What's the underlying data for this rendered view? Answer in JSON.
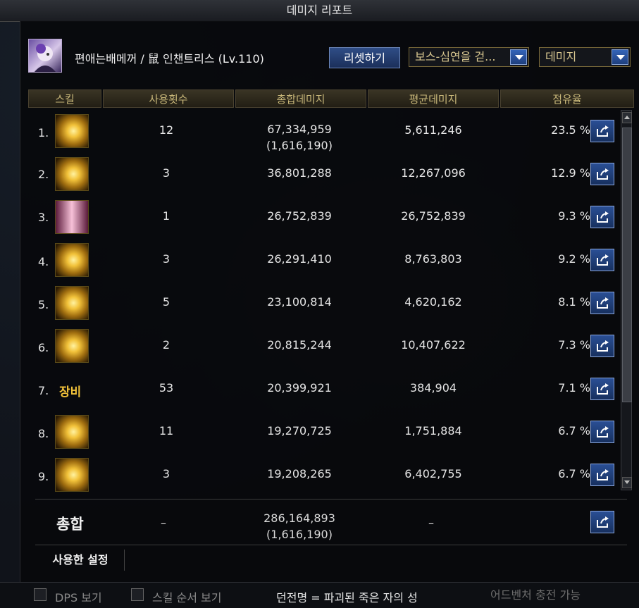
{
  "window": {
    "title": "데미지 리포트"
  },
  "character": {
    "name_line": "편애는배메꺼 / 鼠 인챈트리스 (Lv.110)"
  },
  "controls": {
    "reset_label": "리셋하기",
    "target_select": "보스-심연을 걷...",
    "mode_select": "데미지"
  },
  "columns": [
    "스킬",
    "사용횟수",
    "총합데미지",
    "평균데미지",
    "점유율"
  ],
  "rows": [
    {
      "index": "1.",
      "icon": "golden-horn-skill-icon",
      "count": "12",
      "total": "67,334,959",
      "total_sub": "(1,616,190)",
      "avg": "5,611,246",
      "share": "23.5 %"
    },
    {
      "index": "2.",
      "icon": "golden-burst-skill-icon",
      "count": "3",
      "total": "36,801,288",
      "total_sub": "",
      "avg": "12,267,096",
      "share": "12.9 %"
    },
    {
      "index": "3.",
      "icon": "curtain-skill-icon",
      "count": "1",
      "total": "26,752,839",
      "total_sub": "",
      "avg": "26,752,839",
      "share": "9.3 %"
    },
    {
      "index": "4.",
      "icon": "monster-face-skill-icon",
      "count": "3",
      "total": "26,291,410",
      "total_sub": "",
      "avg": "8,763,803",
      "share": "9.2 %"
    },
    {
      "index": "5.",
      "icon": "explosion-skill-icon",
      "count": "5",
      "total": "23,100,814",
      "total_sub": "",
      "avg": "4,620,162",
      "share": "8.1 %"
    },
    {
      "index": "6.",
      "icon": "golden-beast-skill-icon",
      "count": "2",
      "total": "20,815,244",
      "total_sub": "",
      "avg": "10,407,622",
      "share": "7.3 %"
    },
    {
      "index": "7.",
      "icon": "",
      "label": "장비",
      "count": "53",
      "total": "20,399,921",
      "total_sub": "",
      "avg": "384,904",
      "share": "7.1 %"
    },
    {
      "index": "8.",
      "icon": "golden-swirl-skill-icon",
      "count": "11",
      "total": "19,270,725",
      "total_sub": "",
      "avg": "1,751,884",
      "share": "6.7 %"
    },
    {
      "index": "9.",
      "icon": "golden-doll-skill-icon",
      "count": "3",
      "total": "19,208,265",
      "total_sub": "",
      "avg": "6,402,755",
      "share": "6.7 %"
    }
  ],
  "total": {
    "label": "총합",
    "count": "–",
    "value": "286,164,893",
    "value_sub": "(1,616,190)",
    "avg": "–"
  },
  "used_settings_label": "사용한 설정",
  "footer": {
    "dps_label": "DPS 보기",
    "skill_order_label": "스킬 순서 보기",
    "dungeon_line": "던전명 = 파괴된 죽은 자의 성",
    "right_text": "어드벤처 충전 가능"
  }
}
